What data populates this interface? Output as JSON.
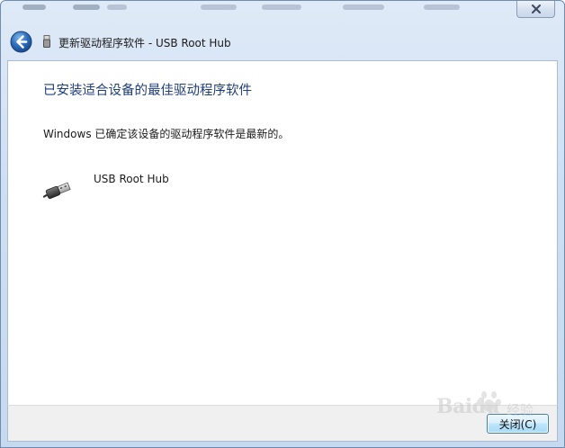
{
  "window": {
    "navigation_title": "更新驱动程序软件 - USB Root Hub"
  },
  "main": {
    "heading": "已安装适合设备的最佳驱动程序软件",
    "status_message": "Windows 已确定该设备的驱动程序软件是最新的。",
    "device_name": "USB Root Hub"
  },
  "footer": {
    "close_label": "关闭(C)"
  },
  "watermark": {
    "brand": "Baidu",
    "suffix": "经验"
  },
  "icons": {
    "back": "back-arrow-icon",
    "window_close": "close-icon",
    "device": "usb-plug-icon",
    "title": "usb-device-icon"
  },
  "colors": {
    "heading": "#1f3f7a",
    "accent": "#3c7fb1",
    "chrome": "#cfdff2"
  }
}
